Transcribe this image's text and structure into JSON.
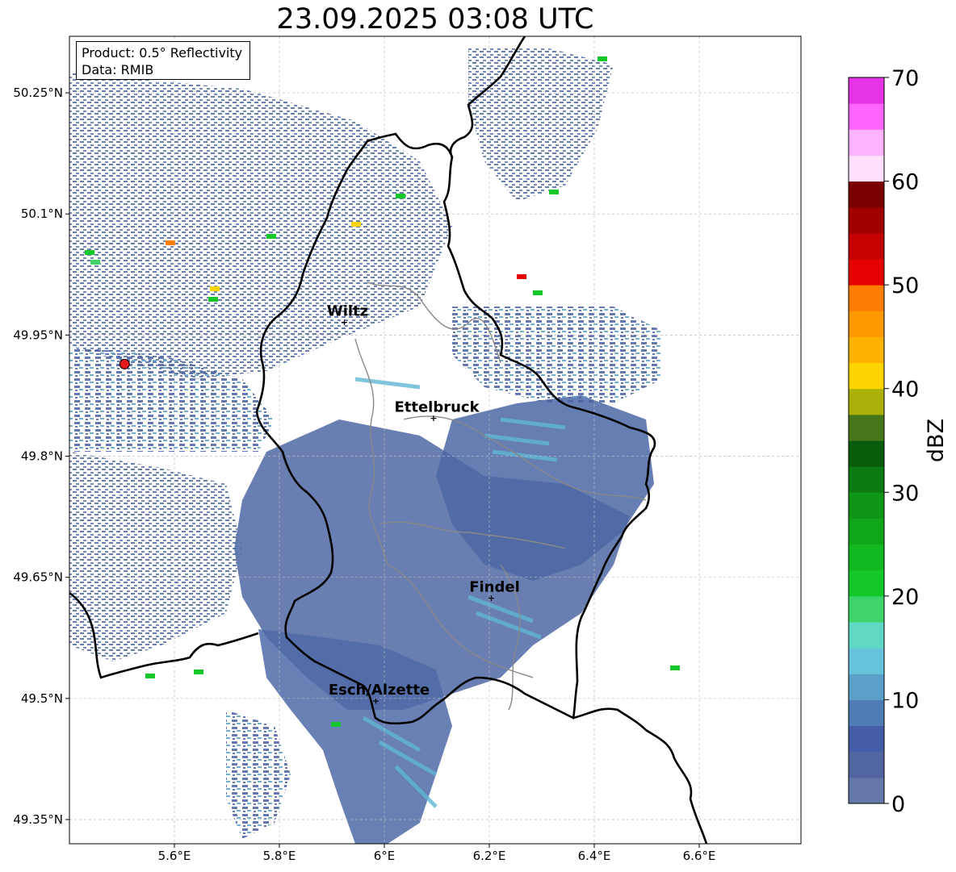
{
  "title": "23.09.2025 03:08 UTC",
  "info": {
    "product": "Product: 0.5° Reflectivity",
    "data": "Data: RMIB"
  },
  "map": {
    "lon_range": [
      5.4,
      6.8
    ],
    "lat_range": [
      49.32,
      50.32
    ],
    "x_ticks": [
      {
        "value": 5.6,
        "label": "5.6°E"
      },
      {
        "value": 5.8,
        "label": "5.8°E"
      },
      {
        "value": 6.0,
        "label": "6°E"
      },
      {
        "value": 6.2,
        "label": "6.2°E"
      },
      {
        "value": 6.4,
        "label": "6.4°E"
      },
      {
        "value": 6.6,
        "label": "6.6°E"
      }
    ],
    "y_ticks": [
      {
        "value": 50.25,
        "label": "50.25°N"
      },
      {
        "value": 50.1,
        "label": "50.1°N"
      },
      {
        "value": 49.95,
        "label": "49.95°N"
      },
      {
        "value": 49.8,
        "label": "49.8°N"
      },
      {
        "value": 49.65,
        "label": "49.65°N"
      },
      {
        "value": 49.5,
        "label": "49.5°N"
      },
      {
        "value": 49.35,
        "label": "49.35°N"
      }
    ],
    "cities": [
      {
        "name": "Wiltz",
        "lon": 5.93,
        "lat": 49.966
      },
      {
        "name": "Ettelbruck",
        "lon": 6.1,
        "lat": 49.847
      },
      {
        "name": "Findel",
        "lon": 6.21,
        "lat": 49.624
      },
      {
        "name": "Esch/Alzette",
        "lon": 5.99,
        "lat": 49.497
      }
    ],
    "radar_site": {
      "lon": 5.505,
      "lat": 49.914,
      "color": "#e31a1c"
    },
    "border_color": "#000000",
    "canton_color": "#888888",
    "grid_color": "#bbbbbb"
  },
  "colorbar": {
    "label": "dBZ",
    "min": 0,
    "max": 70,
    "step": 2.5,
    "ticks": [
      0,
      10,
      20,
      30,
      40,
      50,
      60,
      70
    ],
    "colors": [
      "#6377a8",
      "#5166a0",
      "#435ea6",
      "#4f7bb6",
      "#5ba0c8",
      "#66c3dc",
      "#5fd8c4",
      "#3ed46a",
      "#14c82a",
      "#11b81f",
      "#10a61a",
      "#0f9616",
      "#0c7a12",
      "#095c0c",
      "#47761a",
      "#aab008",
      "#ffd400",
      "#ffb300",
      "#ff9900",
      "#ff7d00",
      "#e40000",
      "#c40000",
      "#a00000",
      "#7a0000",
      "#ffe0ff",
      "#ffb3ff",
      "#ff66ff",
      "#e633e6"
    ]
  }
}
